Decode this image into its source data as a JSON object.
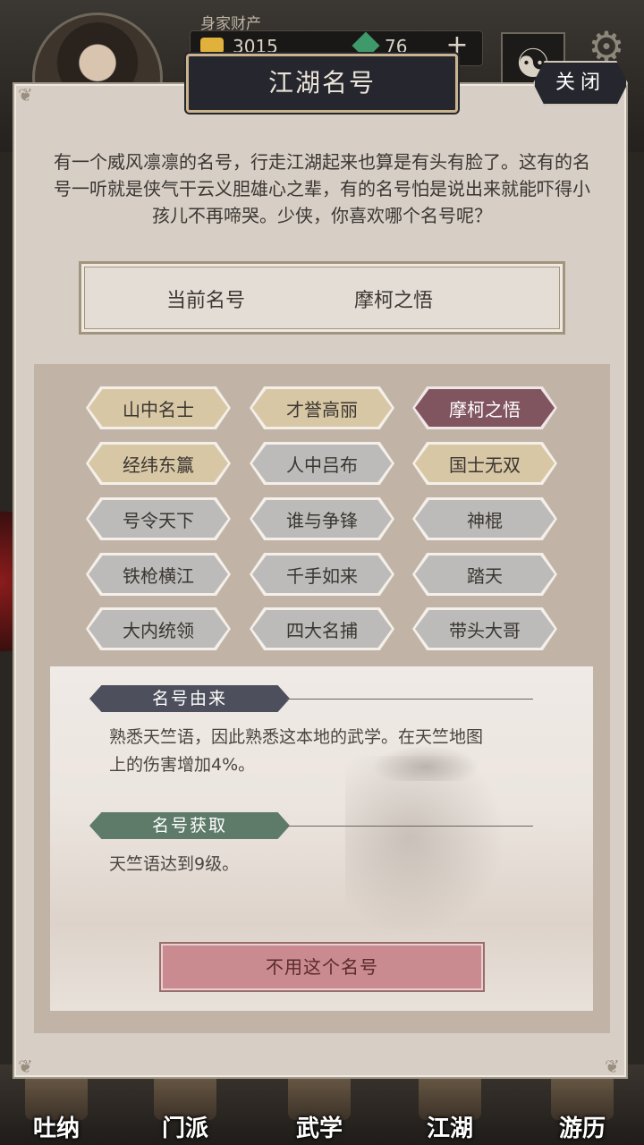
{
  "hud": {
    "wealth_label": "身家财产",
    "gold": "3015",
    "jade": "76",
    "plus": "+",
    "taiji_glyph": "☯",
    "gear_glyph": "⚙"
  },
  "nav": [
    "吐纳",
    "门派",
    "武学",
    "江湖",
    "游历"
  ],
  "modal": {
    "title": "江湖名号",
    "close_label": "关闭",
    "intro": "有一个威风凛凛的名号，行走江湖起来也算是有头有脸了。这有的名号一听就是侠气干云义胆雄心之辈，有的名号怕是说出来就能吓得小孩儿不再啼哭。少侠，你喜欢哪个名号呢？",
    "current_label": "当前名号",
    "current_value": "摩柯之悟"
  },
  "titles": [
    [
      "山中名士",
      "才誉高丽",
      "摩柯之悟"
    ],
    [
      "经纬东籯",
      "人中吕布",
      "国士无双"
    ],
    [
      "号令天下",
      "谁与争锋",
      "神棍"
    ],
    [
      "铁枪横江",
      "千手如来",
      "踏天"
    ],
    [
      "大内统领",
      "四大名捕",
      "带头大哥"
    ]
  ],
  "info": {
    "origin_header": "名号由来",
    "origin_text_1": "熟悉天竺语，因此熟悉这本地的武学。在天竺地图",
    "origin_text_2": "上的伤害增加4%。",
    "obtain_header": "名号获取",
    "obtain_text": "天竺语达到9级。",
    "unuse_button": "不用这个名号"
  },
  "colors": {
    "selected": "#805560",
    "gold_chip": "#d8c7a4",
    "gray_chip": "#bdbbb9",
    "title_plate": "#26262e"
  }
}
